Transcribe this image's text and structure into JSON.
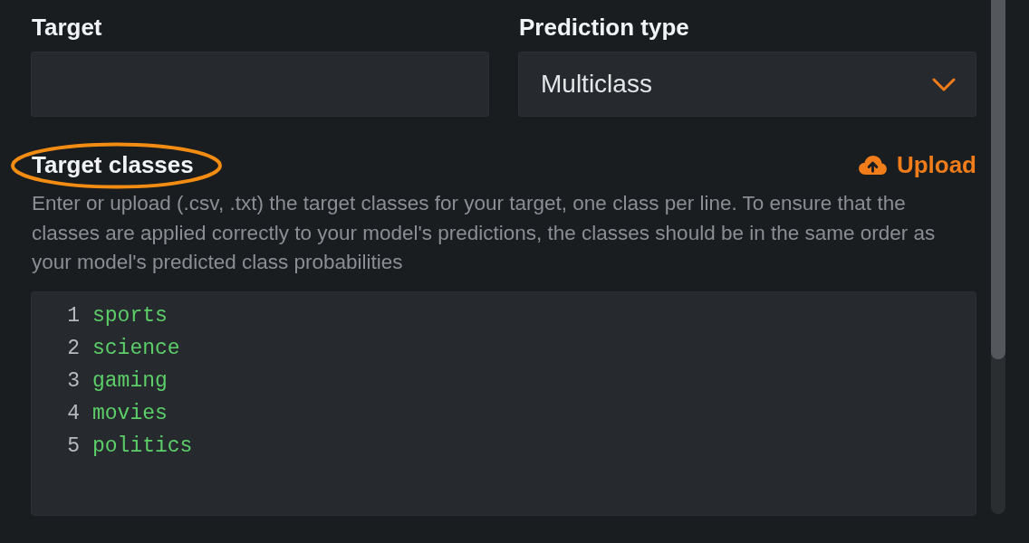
{
  "fields": [
    {
      "label": "Target",
      "kind": "text"
    },
    {
      "label": "Prediction type",
      "kind": "select",
      "value": "Multiclass"
    }
  ],
  "target_classes": {
    "label": "Target classes",
    "highlighted": true,
    "upload_label": "Upload",
    "description": "Enter or upload (.csv, .txt) the target classes for your target, one class per line. To ensure that the classes are applied correctly to your model's predictions, the classes should be in the same order as your model's predicted class probabilities",
    "lines": [
      {
        "number": "1",
        "text": "sports"
      },
      {
        "number": "2",
        "text": "science"
      },
      {
        "number": "3",
        "text": "gaming"
      },
      {
        "number": "4",
        "text": "movies"
      },
      {
        "number": "5",
        "text": "politics"
      }
    ]
  }
}
